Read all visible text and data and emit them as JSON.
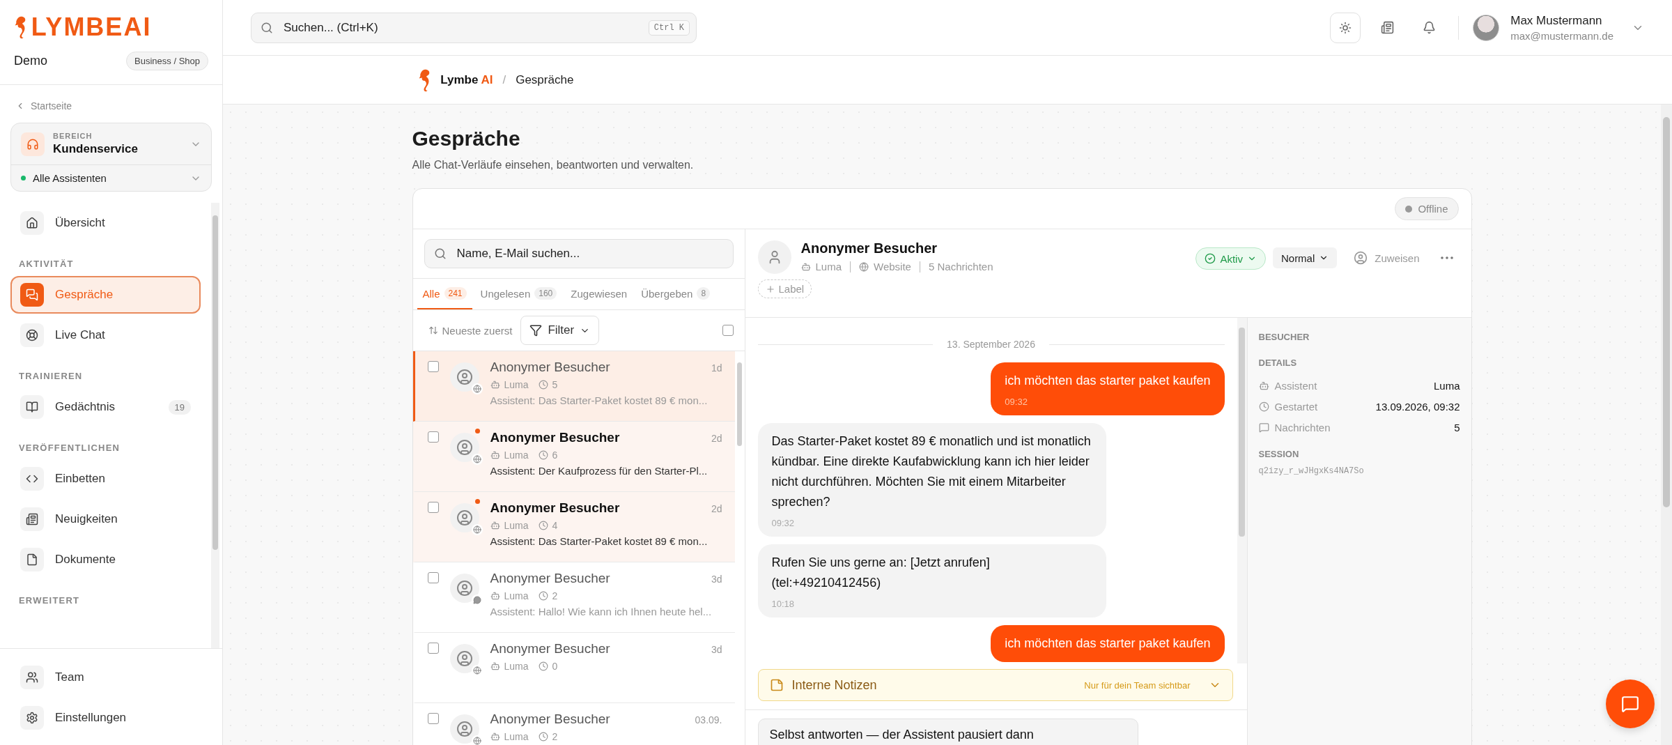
{
  "sidebar": {
    "logo": "LYMBEAI",
    "workspace": "Demo",
    "plan": "Business / Shop",
    "back": "Startseite",
    "area": {
      "label": "BEREICH",
      "name": "Kundenservice",
      "assistants": "Alle Assistenten"
    },
    "groups": [
      {
        "items": [
          {
            "label": "Übersicht",
            "selected": false
          }
        ]
      },
      {
        "heading": "AKTIVITÄT",
        "items": [
          {
            "label": "Gespräche",
            "selected": true
          },
          {
            "label": "Live Chat",
            "selected": false
          }
        ]
      },
      {
        "heading": "TRAINIEREN",
        "items": [
          {
            "label": "Gedächtnis",
            "count": "19",
            "selected": false
          }
        ]
      },
      {
        "heading": "VERÖFFENTLICHEN",
        "items": [
          {
            "label": "Einbetten",
            "selected": false
          },
          {
            "label": "Neuigkeiten",
            "selected": false
          },
          {
            "label": "Dokumente",
            "selected": false
          }
        ]
      },
      {
        "heading": "ERWEITERT"
      }
    ],
    "bottom": [
      {
        "label": "Team",
        "selected": false
      },
      {
        "label": "Einstellungen",
        "selected": false
      }
    ]
  },
  "topbar": {
    "search": {
      "placeholder": "Suchen... (Ctrl+K)",
      "shortcut": "Ctrl K"
    },
    "user": {
      "name": "Max Mustermann",
      "email": "max@mustermann.de"
    }
  },
  "breadcrumb": {
    "brand": "Lymbe",
    "brand_suffix": "AI",
    "separator": "/",
    "page": "Gespräche"
  },
  "page": {
    "title": "Gespräche",
    "subtitle": "Alle Chat-Verläufe einsehen, beantworten und verwalten."
  },
  "status": {
    "label": "Offline",
    "online": false
  },
  "list": {
    "search": {
      "placeholder": "Name, E-Mail suchen..."
    },
    "tabs": [
      {
        "label": "Alle",
        "count": "241",
        "selected": true
      },
      {
        "label": "Ungelesen",
        "count": "160",
        "selected": false
      },
      {
        "label": "Zugewiesen",
        "selected": false
      },
      {
        "label": "Übergeben",
        "count": "8",
        "selected": false
      }
    ],
    "sort": "Neueste zuerst",
    "filter": "Filter",
    "select_all": {
      "checked": false
    },
    "rows": [
      {
        "name": "Anonymer Besucher",
        "time": "1d",
        "assistant": "Luma",
        "messages": "5",
        "preview": "Assistent: Das Starter-Paket kostet 89 € mon...",
        "kind": "web",
        "selected": true,
        "unread": false,
        "checked": false
      },
      {
        "name": "Anonymer Besucher",
        "time": "2d",
        "assistant": "Luma",
        "messages": "6",
        "preview": "Assistent: Der Kaufprozess für den Starter-Pl...",
        "kind": "web",
        "selected": false,
        "unread": true,
        "checked": false
      },
      {
        "name": "Anonymer Besucher",
        "time": "2d",
        "assistant": "Luma",
        "messages": "4",
        "preview": "Assistent: Das Starter-Paket kostet 89 € mon...",
        "kind": "web",
        "selected": false,
        "unread": true,
        "checked": false
      },
      {
        "name": "Anonymer Besucher",
        "time": "3d",
        "assistant": "Luma",
        "messages": "2",
        "preview": "Assistent: Hallo! Wie kann ich Ihnen heute hel...",
        "kind": "chat",
        "selected": false,
        "unread": false,
        "checked": false
      },
      {
        "name": "Anonymer Besucher",
        "time": "3d",
        "assistant": "Luma",
        "messages": "0",
        "kind": "web",
        "selected": false,
        "unread": false,
        "checked": false
      },
      {
        "name": "Anonymer Besucher",
        "time": "03.09.",
        "assistant": "Luma",
        "messages": "2",
        "kind": "web",
        "selected": false,
        "unread": false,
        "checked": false
      }
    ]
  },
  "chat": {
    "visitor": "Anonymer Besucher",
    "assistant": "Luma",
    "channel": "Website",
    "message_count": "5 Nachrichten",
    "label_button": "Label",
    "status": "Aktiv",
    "priority": "Normal",
    "assign": "Zuweisen",
    "date": "13. September 2026",
    "messages": [
      {
        "kind": "outgoing",
        "text": "ich möchten das starter paket kaufen",
        "time": "09:32"
      },
      {
        "kind": "incoming",
        "text": "Das Starter-Paket kostet 89 € monatlich und ist monatlich kündbar. Eine direkte Kaufabwicklung kann ich hier leider nicht durchführen. Möchten Sie mit einem Mitarbeiter sprechen?",
        "time": "09:32"
      },
      {
        "kind": "incoming",
        "text": "Rufen Sie uns gerne an: [Jetzt anrufen] (tel:+49210412456)",
        "time": "10:18"
      },
      {
        "kind": "outgoing",
        "text": "ich möchten das starter paket kaufen"
      }
    ],
    "notes": {
      "title": "Interne Notizen",
      "hint": "Nur für dein Team sichtbar",
      "expanded": false
    },
    "reply": "Selbst antworten — der Assistent pausiert dann"
  },
  "details": {
    "heading": "BESUCHER",
    "section": "DETAILS",
    "rows": [
      {
        "label": "Assistent",
        "value": "Luma"
      },
      {
        "label": "Gestartet",
        "value": "13.09.2026, 09:32"
      },
      {
        "label": "Nachrichten",
        "value": "5"
      }
    ],
    "session_heading": "SESSION",
    "session": "q2izy_r_wJHgxKs4NA7So"
  }
}
